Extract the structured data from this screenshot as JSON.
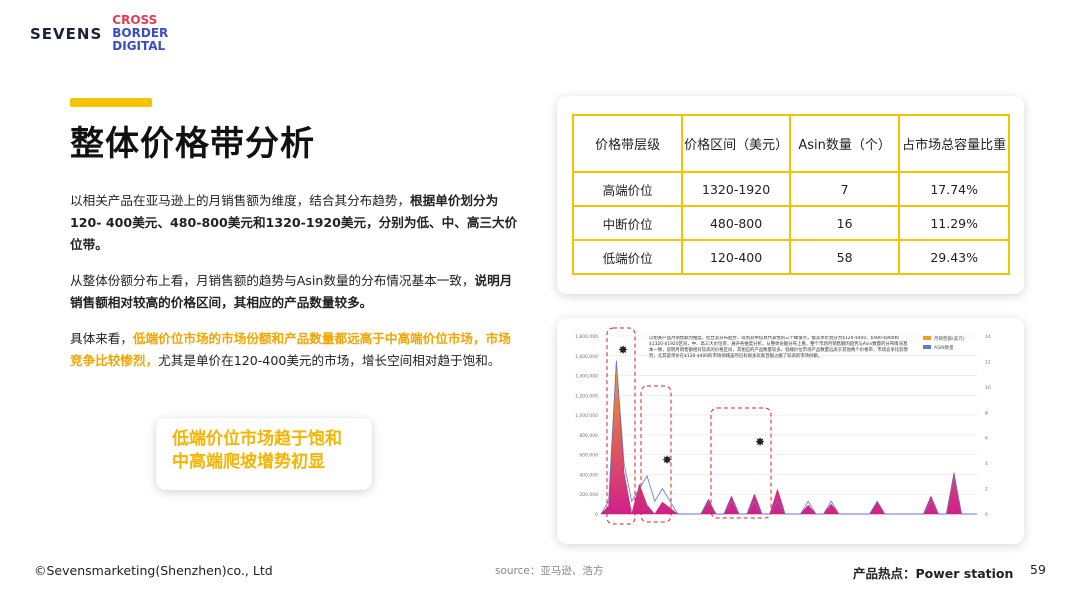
{
  "logo": {
    "brand": "SEVENS",
    "sub_line1": "CROSS",
    "sub_line2": "BORDER",
    "sub_line3": "DIGITAL"
  },
  "title": "整体价格带分析",
  "paragraphs": {
    "p1_plain": "以相关产品在亚马逊上的月销售额为维度，结合其分布趋势，",
    "p1_bold": "根据单价划分为120- 400美元、480-800美元和1320-1920美元，分别为低、中、高三大价位带。",
    "p2_plain": "从整体份额分布上看，月销售额的趋势与Asin数量的分布情况基本一致，",
    "p2_bold": "说明月销售额相对较高的价格区间，其相应的产品数量较多。",
    "p3_plain": "具体来看，",
    "p3_yellow": "低端价位市场的市场份额和产品数量都远高于中高端价位市场，市场竞争比较惨烈，",
    "p3_tail": "尤其是单价在120-400美元的市场，增长空间相对趋于饱和。"
  },
  "callout": {
    "line1": "低端价位市场趋于饱和",
    "line2": "中高端爬坡增势初显"
  },
  "table": {
    "headers": [
      "价格带层级",
      "价格区间（美元）",
      "Asin数量（个）",
      "占市场总容量比重"
    ],
    "rows": [
      [
        "高端价位",
        "1320-1920",
        "7",
        "17.74%"
      ],
      [
        "中断价位",
        "480-800",
        "16",
        "11.29%"
      ],
      [
        "低端价位",
        "120-400",
        "58",
        "29.43%"
      ]
    ]
  },
  "chart_data": {
    "type": "area",
    "title": "",
    "y_left_ticks": [
      "1,800,000",
      "1,600,000",
      "1,400,000",
      "1,200,000",
      "1,000,000",
      "800,000",
      "600,000",
      "400,000",
      "200,000",
      "0"
    ],
    "y_right_ticks": [
      "14",
      "12",
      "10",
      "8",
      "6",
      "4",
      "2",
      "0"
    ],
    "legend": [
      "月销售额(美元)",
      "ASIN数量"
    ],
    "series": [
      {
        "name": "月销售额(美元)",
        "values": [
          0,
          80000,
          1550000,
          420000,
          0,
          300000,
          90000,
          0,
          120000,
          60000,
          0,
          0,
          0,
          0,
          150000,
          0,
          0,
          180000,
          0,
          0,
          200000,
          0,
          0,
          250000,
          0,
          0,
          0,
          90000,
          0,
          0,
          100000,
          0,
          0,
          0,
          0,
          0,
          120000,
          0,
          0,
          0,
          0,
          0,
          0,
          180000,
          0,
          0,
          420000,
          0,
          0,
          0
        ]
      },
      {
        "name": "ASIN数量",
        "values": [
          0,
          1,
          12,
          4,
          1,
          2,
          3,
          1,
          2,
          1,
          0,
          0,
          0,
          0,
          1,
          0,
          0,
          1,
          0,
          0,
          1,
          0,
          0,
          1,
          0,
          0,
          0,
          1,
          0,
          0,
          1,
          0,
          0,
          0,
          0,
          0,
          1,
          0,
          0,
          0,
          0,
          0,
          0,
          1,
          0,
          0,
          3,
          0,
          0,
          0
        ]
      }
    ],
    "annotation": "以相关产品月销售额为维度，结合其分布趋势，得到其中较具代表性的三个峰值点，据其单价划分为$120-$400、$480-$800和$1320-$1920区间，中、高三大价位带，展开各维度分析。从整体份额分布上看，整个市场月销售额的趋势与Asin数量的分布情况基本一致，说明月销售额相对较高的价格区间，其相应的产品数量较多。低端价位市场产品数量远高于其他两个价格带，市场竞争比较惨烈，尤其是单价在$120-$400的市场领域虽然已有很多玩家且都占据了较高的市场份额。"
  },
  "footer": {
    "copyright": "©Sevensmarketing(Shenzhen)co., Ltd",
    "source": "source：亚马逊、浩方",
    "topic": "产品热点：Power station",
    "page": "59"
  },
  "colors": {
    "accent_yellow": "#f5c400",
    "callout_text": "#f5b400",
    "area_magenta": "#d0208a",
    "area_orange": "#f0a020"
  }
}
